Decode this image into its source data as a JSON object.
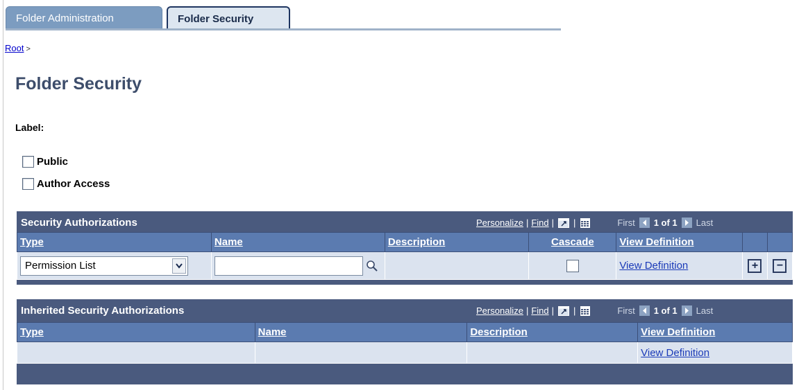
{
  "tabs": [
    {
      "label": "Folder Administration"
    },
    {
      "label": "Folder Security"
    }
  ],
  "breadcrumb": {
    "root": "Root",
    "separator": ">"
  },
  "page_title": "Folder Security",
  "label_text": "Label:",
  "checkboxes": {
    "public": "Public",
    "author_access": "Author Access"
  },
  "grid_tools": {
    "personalize": "Personalize",
    "find": "Find",
    "first": "First",
    "count": "1 of 1",
    "last": "Last"
  },
  "security_grid": {
    "title": "Security Authorizations",
    "columns": [
      "Type",
      "Name",
      "Description",
      "Cascade",
      "View Definition"
    ],
    "row": {
      "type_value": "Permission List",
      "name_value": "",
      "description": "",
      "view_link": "View Definition"
    }
  },
  "inherited_grid": {
    "title": "Inherited Security Authorizations",
    "columns": [
      "Type",
      "Name",
      "Description",
      "View Definition"
    ],
    "row": {
      "view_link": "View Definition"
    }
  },
  "icons": [
    "zoom-icon",
    "download-icon",
    "first-arrow-icon",
    "last-arrow-icon",
    "lookup-icon",
    "dropdown-icon",
    "add-row-icon",
    "delete-row-icon"
  ]
}
